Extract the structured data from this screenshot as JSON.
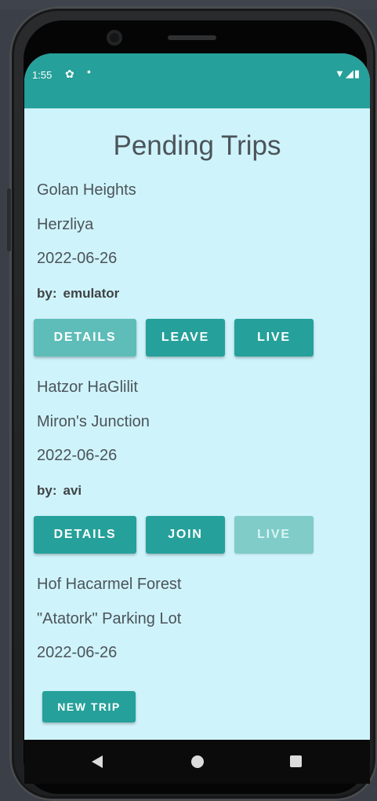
{
  "status_bar": {
    "time": "1:55",
    "icons": [
      "gear-icon",
      "notification-dot-icon",
      "wifi-icon",
      "signal-icon",
      "battery-icon"
    ]
  },
  "page": {
    "title": "Pending Trips",
    "by_label": "by:"
  },
  "trips": [
    {
      "from": "Golan Heights",
      "to": "Herzliya",
      "date": "2022-06-26",
      "by": "emulator",
      "buttons": [
        "DETAILS",
        "LEAVE",
        "LIVE"
      ]
    },
    {
      "from": "Hatzor HaGlilit",
      "to": "Miron's Junction",
      "date": "2022-06-26",
      "by": "avi",
      "buttons": [
        "DETAILS",
        "JOIN",
        "LIVE"
      ]
    },
    {
      "from": "Hof Hacarmel Forest",
      "to": "\"Atatork\" Parking Lot",
      "date": "2022-06-26"
    }
  ],
  "new_trip_button": "NEW TRIP",
  "colors": {
    "primary": "#26a09a",
    "background": "#cff3fb",
    "text": "#4b5459"
  }
}
